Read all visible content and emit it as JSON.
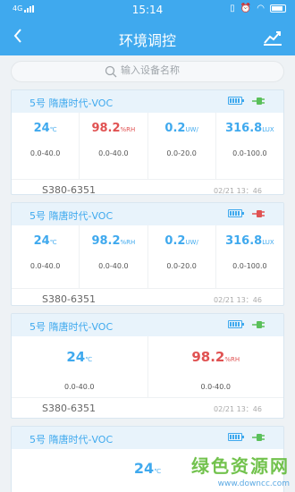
{
  "status_bar": {
    "network": "4G",
    "time": "15:14"
  },
  "nav": {
    "title": "环境调控",
    "back_icon": "chevron-left-icon",
    "chart_icon": "line-chart-icon"
  },
  "search": {
    "placeholder": "输入设备名称"
  },
  "colors": {
    "accent": "#3fa9ee",
    "alert": "#e05252",
    "online": "#5ac05a"
  },
  "cards": [
    {
      "title": "5号 隋唐时代-VOC",
      "plug_status": "connected",
      "metrics": [
        {
          "value": "24",
          "unit": "℃",
          "range": "0.0-40.0"
        },
        {
          "value": "98.2",
          "unit": "%RH",
          "range": "0.0-40.0"
        },
        {
          "value": "0.2",
          "unit": "UW/",
          "range": "0.0-20.0"
        },
        {
          "value": "316.8",
          "unit": "LUX",
          "range": "0.0-100.0"
        }
      ],
      "serial": "S380-6351",
      "timestamp": "02/21 13：46"
    },
    {
      "title": "5号 隋唐时代-VOC",
      "plug_status": "disconnected",
      "metrics": [
        {
          "value": "24",
          "unit": "℃",
          "range": "0.0-40.0"
        },
        {
          "value": "98.2",
          "unit": "%RH",
          "range": "0.0-40.0"
        },
        {
          "value": "0.2",
          "unit": "UW/",
          "range": "0.0-20.0"
        },
        {
          "value": "316.8",
          "unit": "LUX",
          "range": "0.0-100.0"
        }
      ],
      "serial": "S380-6351",
      "timestamp": "02/21 13：46"
    },
    {
      "title": "5号 隋唐时代-VOC",
      "plug_status": "connected",
      "metrics": [
        {
          "value": "24",
          "unit": "℃",
          "range": "0.0-40.0"
        },
        {
          "value": "98.2",
          "unit": "%RH",
          "range": "0.0-40.0"
        }
      ],
      "serial": "S380-6351",
      "timestamp": "02/21 13：46"
    },
    {
      "title": "5号 隋唐时代-VOC",
      "plug_status": "connected",
      "metrics": [
        {
          "value": "24",
          "unit": "℃"
        }
      ]
    }
  ],
  "watermark": {
    "main": "绿色资源网",
    "sub": "www.downcc.com"
  }
}
